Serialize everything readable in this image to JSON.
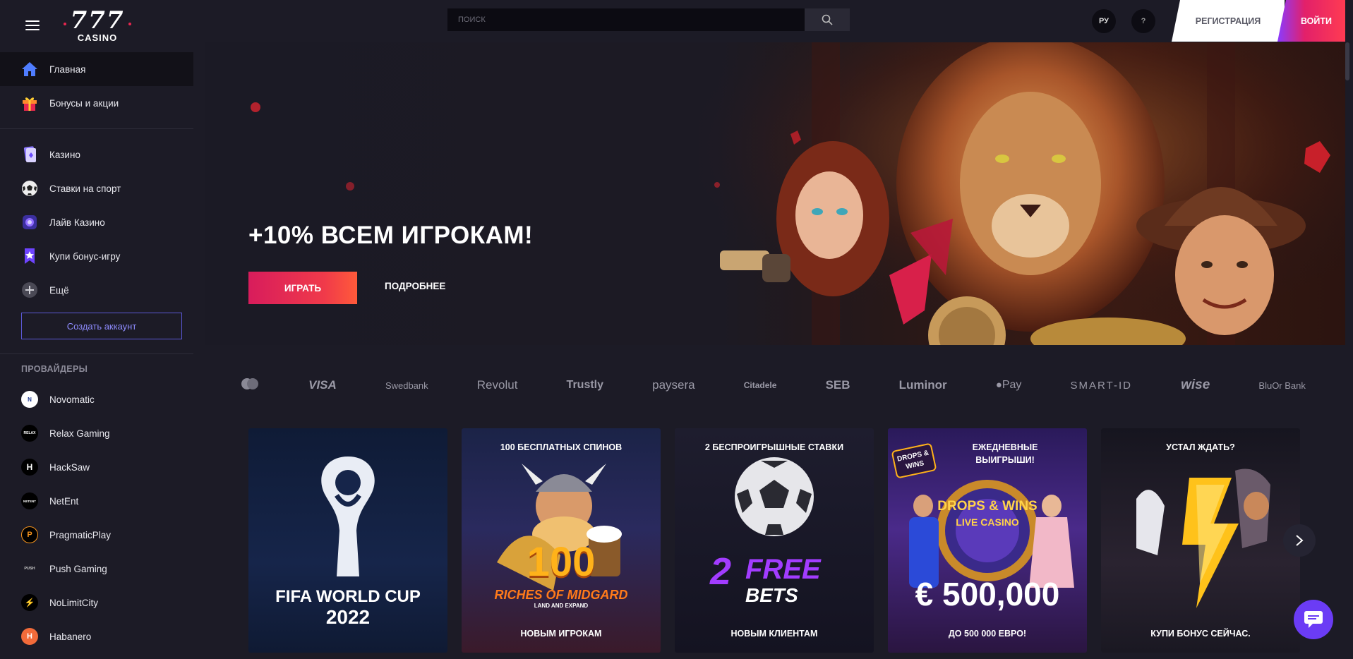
{
  "header": {
    "search_placeholder": "ПОИСК",
    "lang": "РУ",
    "help": "?",
    "register": "РЕГИСТРАЦИЯ",
    "login": "ВОЙТИ"
  },
  "logo": {
    "main": "777",
    "sub": "CASINO"
  },
  "sidebar": {
    "primary": [
      {
        "label": "Главная",
        "icon": "home-icon"
      },
      {
        "label": "Бонусы и акции",
        "icon": "gift-icon"
      }
    ],
    "secondary": [
      {
        "label": "Казино",
        "icon": "cards-icon"
      },
      {
        "label": "Ставки на спорт",
        "icon": "football-icon"
      },
      {
        "label": "Лайв Казино",
        "icon": "live-icon"
      },
      {
        "label": "Купи бонус-игру",
        "icon": "bonus-buy-icon"
      },
      {
        "label": "Ещё",
        "icon": "plus-icon"
      }
    ],
    "create_account": "Создать аккаунт",
    "providers_title": "ПРОВАЙДЕРЫ",
    "providers": [
      {
        "label": "Novomatic",
        "mark": "N"
      },
      {
        "label": "Relax Gaming",
        "mark": "RELAX"
      },
      {
        "label": "HackSaw",
        "mark": "H"
      },
      {
        "label": "NetEnt",
        "mark": "NETENT"
      },
      {
        "label": "PragmaticPlay",
        "mark": "P"
      },
      {
        "label": "Push Gaming",
        "mark": "PUSH"
      },
      {
        "label": "NoLimitCity",
        "mark": "⚡"
      },
      {
        "label": "Habanero",
        "mark": "H"
      }
    ]
  },
  "banner": {
    "title": "+10% ВСЕМ ИГРОКАМ!",
    "play": "ИГРАТЬ",
    "more": "ПОДРОБНЕЕ"
  },
  "payments": [
    "VISA",
    "Swedbank",
    "Revolut",
    "Trustly",
    "paysera",
    "Citadele",
    "SEB",
    "Luminor",
    "Pay",
    "SMART-ID",
    "wise",
    "BluOr Bank"
  ],
  "cards": [
    {
      "top": "",
      "art1": "FIFA WORLD CUP",
      "art2": "2022",
      "bottom": ""
    },
    {
      "top": "100 БЕСПЛАТНЫХ СПИНОВ",
      "art1": "100",
      "art2": "RICHES OF MIDGARD",
      "art3": "LAND AND EXPAND",
      "bottom": "НОВЫМ ИГРОКАМ"
    },
    {
      "top": "2 БЕСПРОИГРЫШНЫЕ СТАВКИ",
      "art1": "2",
      "art2": "FREE",
      "art3": "BETS",
      "bottom": "НОВЫМ КЛИЕНТАМ"
    },
    {
      "top": "ЕЖЕДНЕВНЫЕ ВЫИГРЫШИ!",
      "badge": "DROPS & WINS",
      "art1": "DROPS & WINS",
      "art2": "LIVE CASINO",
      "art3": "€ 500,000",
      "bottom": "ДО 500 000 ЕВРО!"
    },
    {
      "top": "УСТАЛ ЖДАТЬ?",
      "bottom": "КУПИ БОНУС СЕЙЧАС."
    }
  ],
  "colors": {
    "bg": "#1c1b26",
    "accent_red": "#e2206a",
    "accent_purple": "#6b3cf5"
  }
}
